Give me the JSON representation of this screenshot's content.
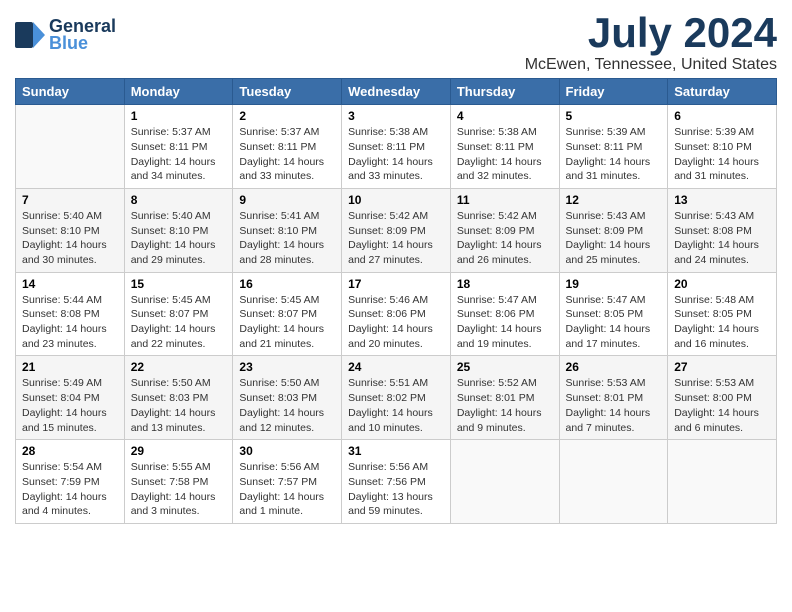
{
  "logo": {
    "line1": "General",
    "line2": "Blue",
    "icon": "▶"
  },
  "title": "July 2024",
  "location": "McEwen, Tennessee, United States",
  "days_header": [
    "Sunday",
    "Monday",
    "Tuesday",
    "Wednesday",
    "Thursday",
    "Friday",
    "Saturday"
  ],
  "weeks": [
    [
      {
        "day": "",
        "info": ""
      },
      {
        "day": "1",
        "info": "Sunrise: 5:37 AM\nSunset: 8:11 PM\nDaylight: 14 hours\nand 34 minutes."
      },
      {
        "day": "2",
        "info": "Sunrise: 5:37 AM\nSunset: 8:11 PM\nDaylight: 14 hours\nand 33 minutes."
      },
      {
        "day": "3",
        "info": "Sunrise: 5:38 AM\nSunset: 8:11 PM\nDaylight: 14 hours\nand 33 minutes."
      },
      {
        "day": "4",
        "info": "Sunrise: 5:38 AM\nSunset: 8:11 PM\nDaylight: 14 hours\nand 32 minutes."
      },
      {
        "day": "5",
        "info": "Sunrise: 5:39 AM\nSunset: 8:11 PM\nDaylight: 14 hours\nand 31 minutes."
      },
      {
        "day": "6",
        "info": "Sunrise: 5:39 AM\nSunset: 8:10 PM\nDaylight: 14 hours\nand 31 minutes."
      }
    ],
    [
      {
        "day": "7",
        "info": "Sunrise: 5:40 AM\nSunset: 8:10 PM\nDaylight: 14 hours\nand 30 minutes."
      },
      {
        "day": "8",
        "info": "Sunrise: 5:40 AM\nSunset: 8:10 PM\nDaylight: 14 hours\nand 29 minutes."
      },
      {
        "day": "9",
        "info": "Sunrise: 5:41 AM\nSunset: 8:10 PM\nDaylight: 14 hours\nand 28 minutes."
      },
      {
        "day": "10",
        "info": "Sunrise: 5:42 AM\nSunset: 8:09 PM\nDaylight: 14 hours\nand 27 minutes."
      },
      {
        "day": "11",
        "info": "Sunrise: 5:42 AM\nSunset: 8:09 PM\nDaylight: 14 hours\nand 26 minutes."
      },
      {
        "day": "12",
        "info": "Sunrise: 5:43 AM\nSunset: 8:09 PM\nDaylight: 14 hours\nand 25 minutes."
      },
      {
        "day": "13",
        "info": "Sunrise: 5:43 AM\nSunset: 8:08 PM\nDaylight: 14 hours\nand 24 minutes."
      }
    ],
    [
      {
        "day": "14",
        "info": "Sunrise: 5:44 AM\nSunset: 8:08 PM\nDaylight: 14 hours\nand 23 minutes."
      },
      {
        "day": "15",
        "info": "Sunrise: 5:45 AM\nSunset: 8:07 PM\nDaylight: 14 hours\nand 22 minutes."
      },
      {
        "day": "16",
        "info": "Sunrise: 5:45 AM\nSunset: 8:07 PM\nDaylight: 14 hours\nand 21 minutes."
      },
      {
        "day": "17",
        "info": "Sunrise: 5:46 AM\nSunset: 8:06 PM\nDaylight: 14 hours\nand 20 minutes."
      },
      {
        "day": "18",
        "info": "Sunrise: 5:47 AM\nSunset: 8:06 PM\nDaylight: 14 hours\nand 19 minutes."
      },
      {
        "day": "19",
        "info": "Sunrise: 5:47 AM\nSunset: 8:05 PM\nDaylight: 14 hours\nand 17 minutes."
      },
      {
        "day": "20",
        "info": "Sunrise: 5:48 AM\nSunset: 8:05 PM\nDaylight: 14 hours\nand 16 minutes."
      }
    ],
    [
      {
        "day": "21",
        "info": "Sunrise: 5:49 AM\nSunset: 8:04 PM\nDaylight: 14 hours\nand 15 minutes."
      },
      {
        "day": "22",
        "info": "Sunrise: 5:50 AM\nSunset: 8:03 PM\nDaylight: 14 hours\nand 13 minutes."
      },
      {
        "day": "23",
        "info": "Sunrise: 5:50 AM\nSunset: 8:03 PM\nDaylight: 14 hours\nand 12 minutes."
      },
      {
        "day": "24",
        "info": "Sunrise: 5:51 AM\nSunset: 8:02 PM\nDaylight: 14 hours\nand 10 minutes."
      },
      {
        "day": "25",
        "info": "Sunrise: 5:52 AM\nSunset: 8:01 PM\nDaylight: 14 hours\nand 9 minutes."
      },
      {
        "day": "26",
        "info": "Sunrise: 5:53 AM\nSunset: 8:01 PM\nDaylight: 14 hours\nand 7 minutes."
      },
      {
        "day": "27",
        "info": "Sunrise: 5:53 AM\nSunset: 8:00 PM\nDaylight: 14 hours\nand 6 minutes."
      }
    ],
    [
      {
        "day": "28",
        "info": "Sunrise: 5:54 AM\nSunset: 7:59 PM\nDaylight: 14 hours\nand 4 minutes."
      },
      {
        "day": "29",
        "info": "Sunrise: 5:55 AM\nSunset: 7:58 PM\nDaylight: 14 hours\nand 3 minutes."
      },
      {
        "day": "30",
        "info": "Sunrise: 5:56 AM\nSunset: 7:57 PM\nDaylight: 14 hours\nand 1 minute."
      },
      {
        "day": "31",
        "info": "Sunrise: 5:56 AM\nSunset: 7:56 PM\nDaylight: 13 hours\nand 59 minutes."
      },
      {
        "day": "",
        "info": ""
      },
      {
        "day": "",
        "info": ""
      },
      {
        "day": "",
        "info": ""
      }
    ]
  ]
}
